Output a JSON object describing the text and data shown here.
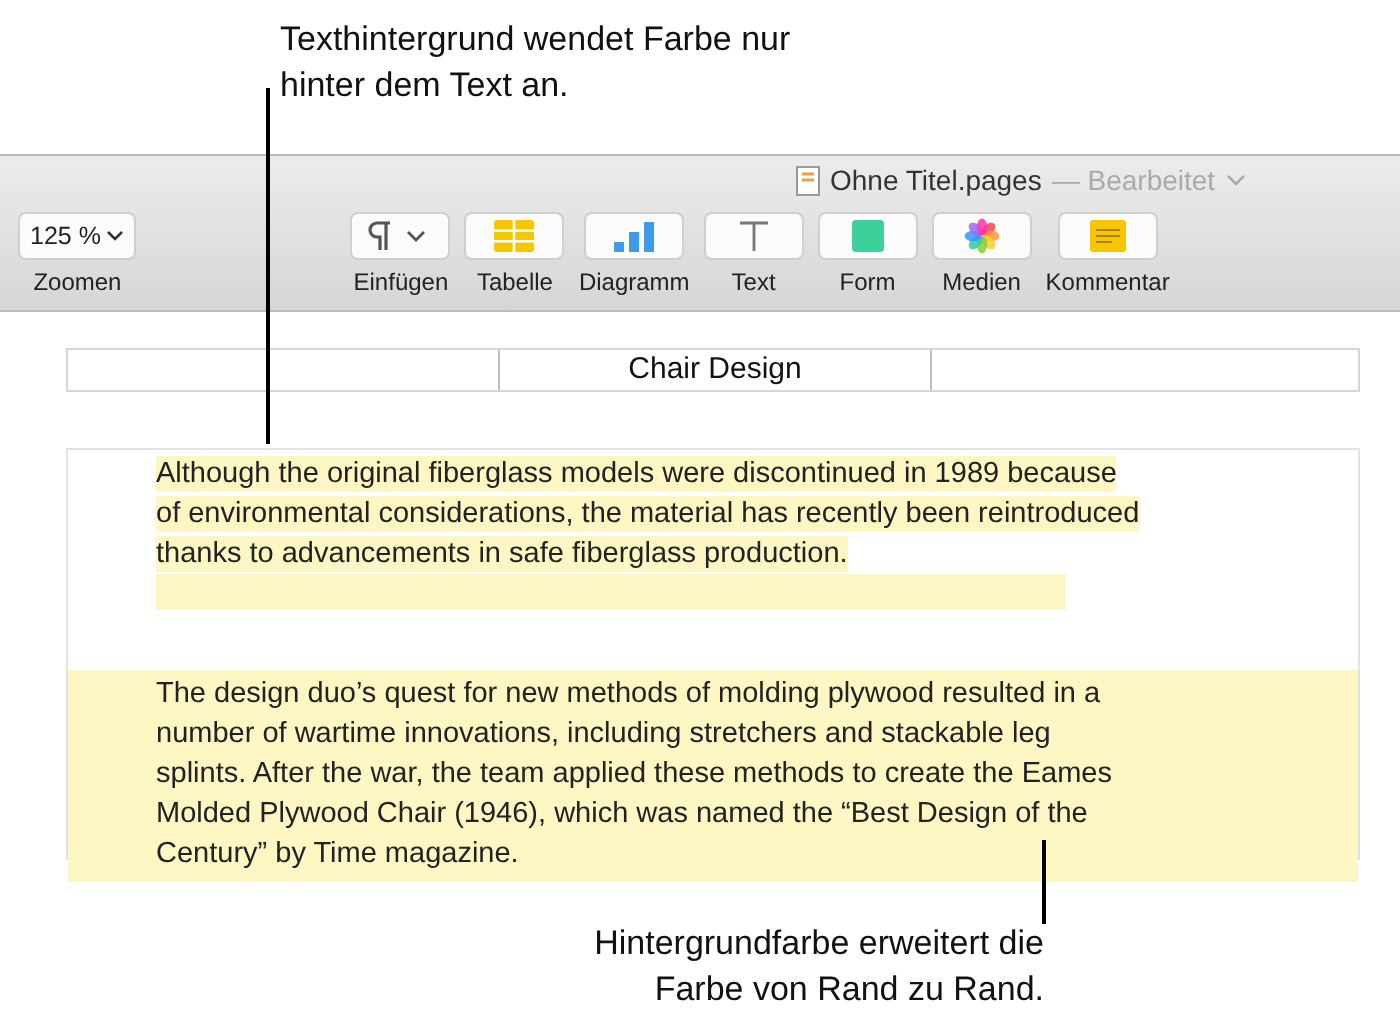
{
  "callouts": {
    "top": "Texthintergrund wendet Farbe nur hinter dem Text an.",
    "bottom": "Hintergrundfarbe erweitert die Farbe von Rand zu Rand."
  },
  "window": {
    "title": "Ohne Titel.pages",
    "status": "— Bearbeitet"
  },
  "zoom": {
    "value": "125 %",
    "label": "Zoomen"
  },
  "toolbar": [
    {
      "kind": "insert",
      "label": "Einfügen"
    },
    {
      "kind": "table",
      "label": "Tabelle"
    },
    {
      "kind": "chart",
      "label": "Diagramm"
    },
    {
      "kind": "text",
      "label": "Text"
    },
    {
      "kind": "shape",
      "label": "Form"
    },
    {
      "kind": "media",
      "label": "Medien"
    },
    {
      "kind": "comment",
      "label": "Kommentar"
    }
  ],
  "document": {
    "header_title": "Chair Design",
    "paragraphs": [
      {
        "kind": "text_highlight",
        "text": "Although the original fiberglass models were discontinued in 1989 because of environmental considerations, the material has recently been reintroduced thanks to advancements in safe fiberglass production."
      },
      {
        "kind": "paragraph_highlight",
        "text": "The design duo’s quest for new methods of molding plywood resulted in a number of wartime innovations, including stretchers and stackable leg splints. After the war, the team applied these methods to create the Eames Molded Plywood Chair (1946), which was named the “Best Design of the Century” by Time magazine."
      }
    ]
  }
}
